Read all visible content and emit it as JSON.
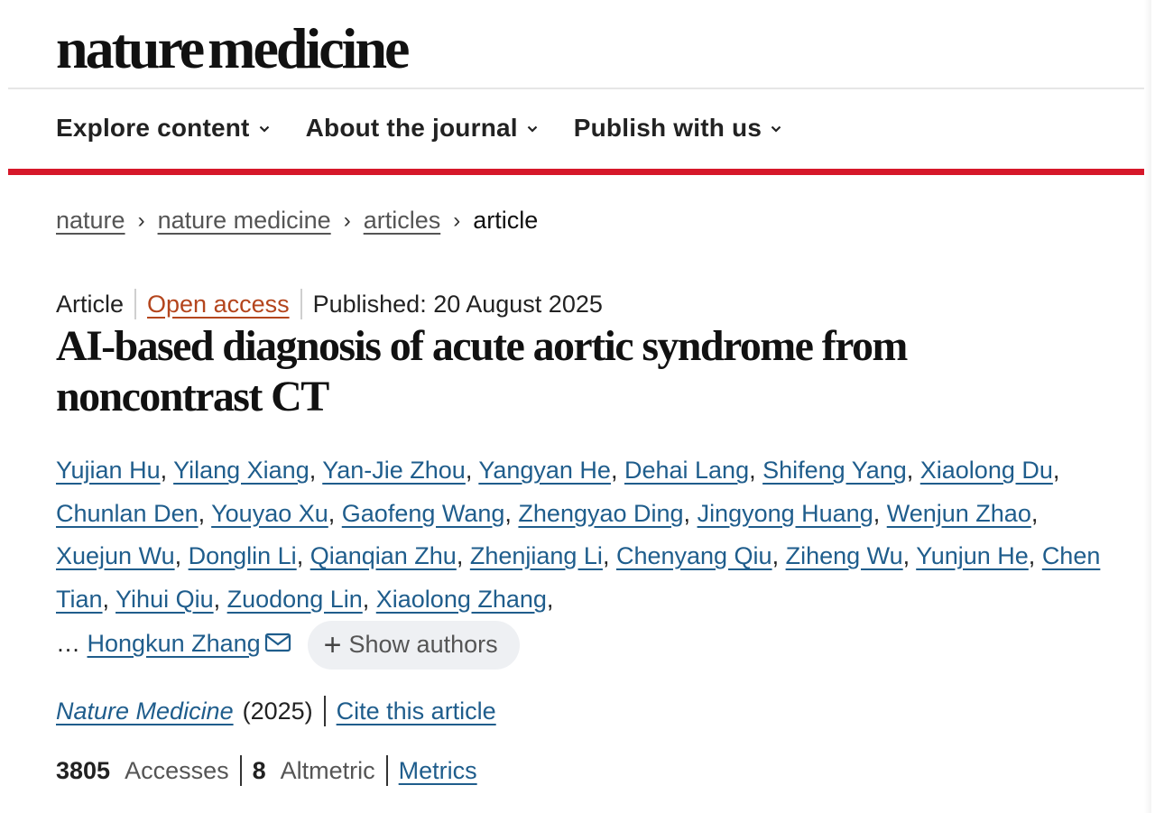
{
  "brand": {
    "word1": "nature",
    "word2": "medicine"
  },
  "nav": {
    "items": [
      {
        "label": "Explore content"
      },
      {
        "label": "About the journal"
      },
      {
        "label": "Publish with us"
      }
    ]
  },
  "breadcrumb": {
    "items": [
      "nature",
      "nature medicine",
      "articles"
    ],
    "current": "article"
  },
  "article": {
    "type": "Article",
    "access": "Open access",
    "published": "Published: 20 August 2025",
    "title": "AI-based diagnosis of acute aortic syndrome from noncontrast CT",
    "authors": [
      "Yujian Hu",
      "Yilang Xiang",
      "Yan-Jie Zhou",
      "Yangyan He",
      "Dehai Lang",
      "Shifeng Yang",
      "Xiaolong Du",
      "Chunlan Den",
      "Youyao Xu",
      "Gaofeng Wang",
      "Zhengyao Ding",
      "Jingyong Huang",
      "Wenjun Zhao",
      "Xuejun Wu",
      "Donglin Li",
      "Qianqian Zhu",
      "Zhenjiang Li",
      "Chenyang Qiu",
      "Ziheng Wu",
      "Yunjun He",
      "Chen Tian",
      "Yihui Qiu",
      "Zuodong Lin",
      "Xiaolong Zhang"
    ],
    "ellipsis": "…",
    "corresponding_author": "Hongkun Zhang",
    "show_authors_label": "Show authors",
    "journal": "Nature Medicine",
    "year": "(2025)",
    "cite_label": "Cite this article",
    "accesses_count": "3805",
    "accesses_label": "Accesses",
    "altmetric_count": "8",
    "altmetric_label": "Altmetric",
    "metrics_label": "Metrics"
  },
  "colors": {
    "accent_red": "#d6182a",
    "link_blue": "#1f5d8c",
    "open_access": "#b4451d"
  }
}
